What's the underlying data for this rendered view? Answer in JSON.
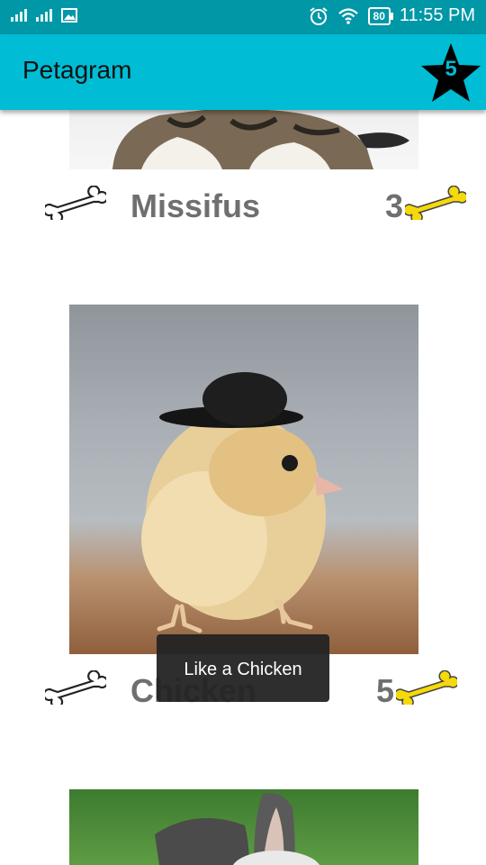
{
  "status_bar": {
    "time": "11:55 PM",
    "battery": "80",
    "icons": [
      "signal-icon",
      "signal-2-icon",
      "gallery-icon",
      "alarm-icon",
      "wifi-icon",
      "battery-icon"
    ]
  },
  "app_bar": {
    "title": "Petagram",
    "favorites_count": "5",
    "favorites_icon": "star-icon",
    "background": "#00bcd4",
    "status_bar_color": "#0097a7"
  },
  "pets": [
    {
      "name": "Missifus",
      "likes": "3",
      "like_icon": "bone-outline-icon",
      "count_icon": "bone-yellow-icon"
    },
    {
      "name": "Chicken",
      "likes": "5",
      "like_icon": "bone-outline-icon",
      "count_icon": "bone-yellow-icon"
    }
  ],
  "toast": {
    "text": "Like a Chicken"
  },
  "colors": {
    "accent": "#00bcd4",
    "bone_yellow": "#f5d90a",
    "text_gray": "#6f6f6f"
  }
}
